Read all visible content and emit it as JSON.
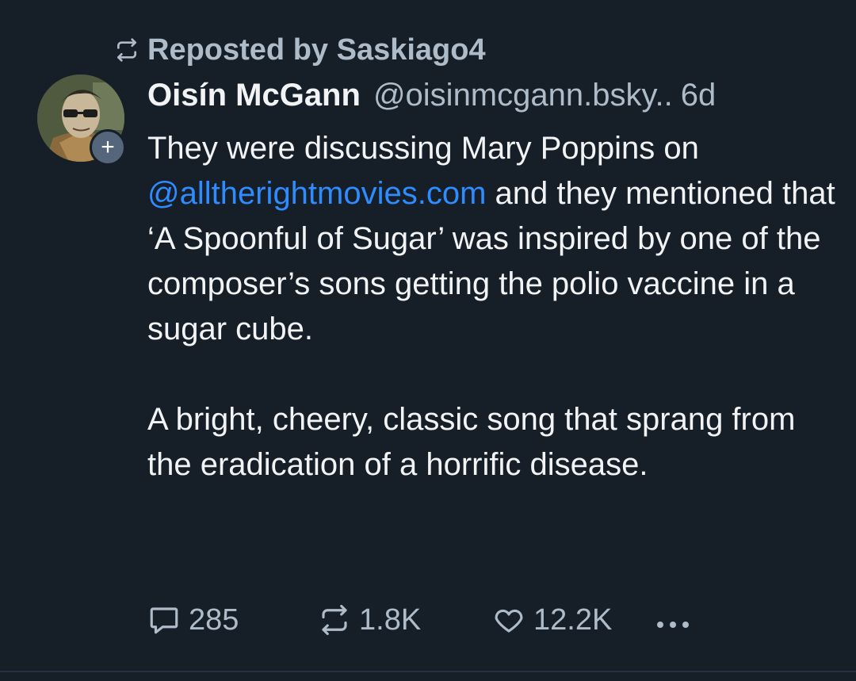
{
  "repost": {
    "label": "Reposted by Saskiago4",
    "icon": "repost-icon"
  },
  "author": {
    "display_name": "Oisín McGann",
    "handle": "@oisinmcgann.bsky..",
    "age": "6d",
    "follow_icon": "plus-icon"
  },
  "post": {
    "p1_before": "They were discussing Mary Poppins on ",
    "mention": "@alltherightmovies.com",
    "p1_after": " and they mentioned that ‘A Spoonful of Sugar’ was inspired by one of the composer’s sons getting the polio vaccine in a sugar cube.",
    "p2": "A bright, cheery, classic song that sprang from the eradication of a horrific disease."
  },
  "actions": {
    "replies": "285",
    "reposts": "1.8K",
    "likes": "12.2K"
  },
  "colors": {
    "background": "#161e27",
    "text": "#f1f3f5",
    "muted": "#aebbc9",
    "link": "#2f8cff"
  }
}
